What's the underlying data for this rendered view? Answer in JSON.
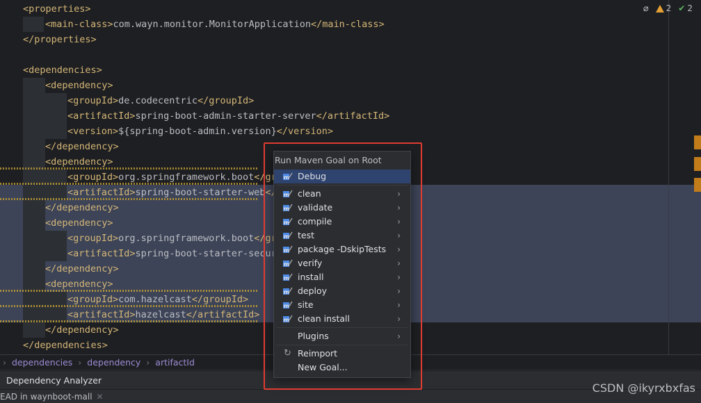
{
  "editor": {
    "lines": [
      {
        "indent": 1,
        "parts": [
          {
            "t": "tag",
            "v": "<properties>"
          }
        ]
      },
      {
        "indent": 2,
        "parts": [
          {
            "t": "tag",
            "v": "<main-class>"
          },
          {
            "t": "txt",
            "v": "com.wayn.monitor.MonitorApplication"
          },
          {
            "t": "tag",
            "v": "</main-class>"
          }
        ]
      },
      {
        "indent": 1,
        "parts": [
          {
            "t": "tag",
            "v": "</properties>"
          }
        ]
      },
      {
        "indent": 1,
        "parts": []
      },
      {
        "indent": 1,
        "parts": [
          {
            "t": "tag",
            "v": "<dependencies>"
          }
        ]
      },
      {
        "indent": 2,
        "parts": [
          {
            "t": "tag",
            "v": "<dependency>"
          }
        ]
      },
      {
        "indent": 3,
        "parts": [
          {
            "t": "tag",
            "v": "<groupId>"
          },
          {
            "t": "txt",
            "v": "de.codecentric"
          },
          {
            "t": "tag",
            "v": "</groupId>"
          }
        ]
      },
      {
        "indent": 3,
        "parts": [
          {
            "t": "tag",
            "v": "<artifactId>"
          },
          {
            "t": "txt",
            "v": "spring-boot-admin-starter-server"
          },
          {
            "t": "tag",
            "v": "</artifactId>"
          }
        ]
      },
      {
        "indent": 3,
        "parts": [
          {
            "t": "tag",
            "v": "<version>"
          },
          {
            "t": "txt",
            "v": "${spring-boot-admin.version}"
          },
          {
            "t": "tag",
            "v": "</version>"
          }
        ]
      },
      {
        "indent": 2,
        "parts": [
          {
            "t": "tag",
            "v": "</dependency>"
          }
        ]
      },
      {
        "indent": 2,
        "parts": [
          {
            "t": "tag",
            "v": "<dependency>"
          }
        ],
        "warn": true
      },
      {
        "indent": 3,
        "parts": [
          {
            "t": "tag",
            "v": "<groupId>"
          },
          {
            "t": "txt",
            "v": "org.springframework.boot"
          },
          {
            "t": "tag",
            "v": "</gr"
          }
        ],
        "warn": true
      },
      {
        "indent": 3,
        "parts": [
          {
            "t": "tag",
            "v": "<artifactId>"
          },
          {
            "t": "txt",
            "v": "spring-boot-starter-web"
          },
          {
            "t": "tag",
            "v": "</"
          }
        ],
        "warn": true
      },
      {
        "indent": 2,
        "parts": [
          {
            "t": "tag",
            "v": "</dependency>"
          }
        ]
      },
      {
        "indent": 2,
        "parts": [
          {
            "t": "tag",
            "v": "<dependency>"
          }
        ]
      },
      {
        "indent": 3,
        "parts": [
          {
            "t": "tag",
            "v": "<groupId>"
          },
          {
            "t": "txt",
            "v": "org.springframework.boot"
          },
          {
            "t": "tag",
            "v": "</gr"
          }
        ]
      },
      {
        "indent": 3,
        "parts": [
          {
            "t": "tag",
            "v": "<artifactId>"
          },
          {
            "t": "txt",
            "v": "spring-boot-starter-secur"
          }
        ]
      },
      {
        "indent": 2,
        "parts": [
          {
            "t": "tag",
            "v": "</dependency>"
          }
        ]
      },
      {
        "indent": 2,
        "parts": [
          {
            "t": "tag",
            "v": "<dependency>"
          }
        ],
        "warn": true
      },
      {
        "indent": 3,
        "parts": [
          {
            "t": "tag",
            "v": "<groupId>"
          },
          {
            "t": "txt",
            "v": "com.hazelcast"
          },
          {
            "t": "tag",
            "v": "</groupId>"
          }
        ],
        "warn": true
      },
      {
        "indent": 3,
        "parts": [
          {
            "t": "tag",
            "v": "<artifactId>"
          },
          {
            "t": "txt",
            "v": "hazelcast"
          },
          {
            "t": "tag",
            "v": "</artifactId>"
          }
        ],
        "warn": true
      },
      {
        "indent": 2,
        "parts": [
          {
            "t": "tag",
            "v": "</dependency>"
          }
        ]
      },
      {
        "indent": 1,
        "parts": [
          {
            "t": "tag",
            "v": "</dependencies>"
          }
        ]
      }
    ]
  },
  "inspections": {
    "warnings": "2",
    "checks": "2"
  },
  "popup": {
    "title": "Run Maven Goal on Root Module",
    "items": [
      {
        "label": "Debug",
        "icon": "maven-icon",
        "submenu": false,
        "selected": true
      },
      {
        "sep": true
      },
      {
        "label": "clean",
        "icon": "maven-icon",
        "submenu": true
      },
      {
        "label": "validate",
        "icon": "maven-icon",
        "submenu": true
      },
      {
        "label": "compile",
        "icon": "maven-icon",
        "submenu": true
      },
      {
        "label": "test",
        "icon": "maven-icon",
        "submenu": true
      },
      {
        "label": "package -DskipTests",
        "icon": "maven-icon",
        "submenu": true
      },
      {
        "label": "verify",
        "icon": "maven-icon",
        "submenu": true
      },
      {
        "label": "install",
        "icon": "maven-icon",
        "submenu": true
      },
      {
        "label": "deploy",
        "icon": "maven-icon",
        "submenu": true
      },
      {
        "label": "site",
        "icon": "maven-icon",
        "submenu": true
      },
      {
        "label": "clean install",
        "icon": "maven-icon",
        "submenu": true
      },
      {
        "sep": true
      },
      {
        "label": "Plugins",
        "icon": "",
        "submenu": true
      },
      {
        "sep": true
      },
      {
        "label": "Reimport",
        "icon": "reimport-icon",
        "submenu": false
      },
      {
        "label": "New Goal...",
        "icon": "",
        "submenu": false
      }
    ]
  },
  "breadcrumb": [
    "dependencies",
    "dependency",
    "artifactId"
  ],
  "toolwindow": {
    "label": "Dependency Analyzer"
  },
  "statusbar": {
    "text": "EAD in waynboot-mall"
  },
  "watermark": "CSDN @ikyrxbxfas"
}
